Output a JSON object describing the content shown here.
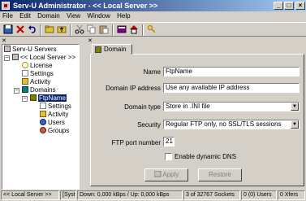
{
  "window": {
    "title": "Serv-U Administrator - << Local Server >>"
  },
  "menu": [
    "File",
    "Edit",
    "Domain",
    "View",
    "Window",
    "Help"
  ],
  "toolbar": {
    "icons": [
      "save-icon",
      "delete-icon",
      "undo-icon",
      "folder-open-icon",
      "folder-up-icon",
      "cut-icon",
      "copy-icon",
      "paste-icon",
      "book-icon",
      "home-icon",
      "key-icon"
    ]
  },
  "tree": {
    "root": "Serv-U Servers",
    "server": "<< Local Server >>",
    "server_children": [
      "License",
      "Settings",
      "Activity",
      "Domains"
    ],
    "domain": "FtpName",
    "domain_children": [
      "Settings",
      "Activity",
      "Users",
      "Groups"
    ]
  },
  "tab": {
    "label": "Domain"
  },
  "form": {
    "name_label": "Name",
    "name_value": "FtpName",
    "ip_label": "Domain IP address",
    "ip_value": "Use any available IP address",
    "type_label": "Domain type",
    "type_value": "Store in .INI file",
    "security_label": "Security",
    "security_value": "Regular FTP only, no SSL/TLS sessions",
    "port_label": "FTP port number",
    "port_value": "21",
    "dyndns_label": "Enable dynamic DNS"
  },
  "buttons": {
    "apply": "Apply",
    "restore": "Restore"
  },
  "status": {
    "server": "<< Local Server >>",
    "system": "[Syst",
    "speed": "Down: 0,000 kBps / Up: 0,000 kBps",
    "sockets": "3 of 32767 Sockets",
    "users": "0 (0) Users",
    "xfers": "0 Xfers"
  }
}
